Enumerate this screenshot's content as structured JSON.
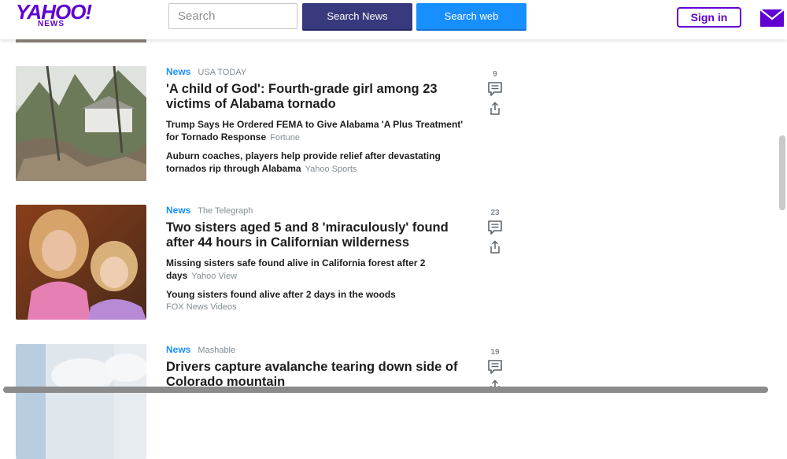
{
  "header": {
    "logo_main": "YAHOO!",
    "logo_sub": "NEWS",
    "search_placeholder": "Search",
    "search_news_label": "Search News",
    "search_web_label": "Search web",
    "signin_label": "Sign in"
  },
  "colors": {
    "brand_purple": "#6001d2",
    "news_button": "#39397d",
    "web_button": "#188fff",
    "category_blue": "#188fff"
  },
  "items": [
    {
      "category": "News",
      "source": "USA TODAY",
      "headline": "'A child of God': Fourth-grade girl among 23 victims of Alabama tornado",
      "comments": "9",
      "related": [
        {
          "title": "Trump Says He Ordered FEMA to Give Alabama 'A Plus Treatment' for Tornado Response",
          "source": "Fortune"
        },
        {
          "title": "Auburn coaches, players help provide relief after devastating tornados rip through Alabama",
          "source": "Yahoo Sports"
        }
      ]
    },
    {
      "category": "News",
      "source": "The Telegraph",
      "headline": "Two sisters aged 5 and 8 'miraculously' found after 44 hours in Californian wilderness",
      "comments": "23",
      "related": [
        {
          "title": "Missing sisters safe found alive in California forest after 2 days",
          "source": "Yahoo View"
        },
        {
          "title": "Young sisters found alive after 2 days in the woods",
          "source": "FOX News Videos"
        }
      ]
    },
    {
      "category": "News",
      "source": "Mashable",
      "headline": "Drivers capture avalanche tearing down side of Colorado mountain",
      "comments": "19",
      "related": []
    }
  ]
}
